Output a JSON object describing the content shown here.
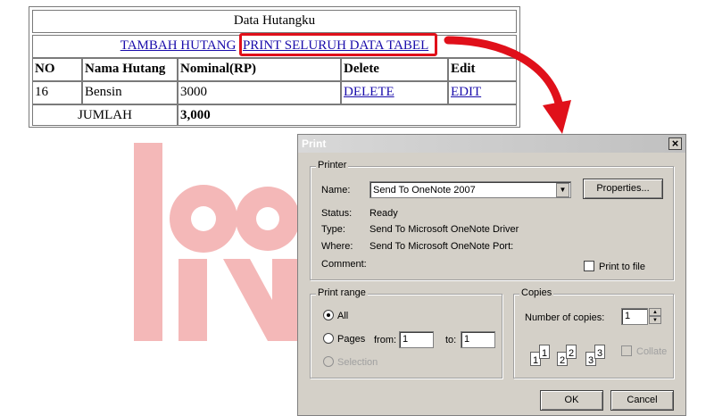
{
  "web": {
    "title": "Data Hutangku",
    "link_add": "TAMBAH HUTANG",
    "link_print": "PRINT SELURUH DATA TABEL",
    "headers": [
      "NO",
      "Nama Hutang",
      "Nominal(RP)",
      "Delete",
      "Edit"
    ],
    "row": {
      "no": "16",
      "name": "Bensin",
      "nominal": "3000",
      "delete": "DELETE",
      "edit": "EDIT"
    },
    "total_label": "JUMLAH",
    "total_value": "3,000"
  },
  "dialog": {
    "title": "Print",
    "close": "×",
    "printer": {
      "group_label": "Printer",
      "name_label": "Name:",
      "name_value": "Send To OneNote 2007",
      "properties_button": "Properties...",
      "status_label": "Status:",
      "status_value": "Ready",
      "type_label": "Type:",
      "type_value": "Send To Microsoft OneNote Driver",
      "where_label": "Where:",
      "where_value": "Send To Microsoft OneNote Port:",
      "comment_label": "Comment:",
      "print_to_file": "Print to file"
    },
    "range": {
      "group_label": "Print range",
      "all": "All",
      "pages": "Pages",
      "from_label": "from:",
      "from_value": "1",
      "to_label": "to:",
      "to_value": "1",
      "selection": "Selection"
    },
    "copies": {
      "group_label": "Copies",
      "number_label": "Number of copies:",
      "number_value": "1",
      "collate": "Collate",
      "icon_digits": [
        "1",
        "1",
        "2",
        "2",
        "3",
        "3"
      ]
    },
    "ok": "OK",
    "cancel": "Cancel"
  },
  "colors": {
    "highlight": "#e0101a",
    "link": "#1a0dab",
    "dialog_bg": "#d4d0c8"
  }
}
